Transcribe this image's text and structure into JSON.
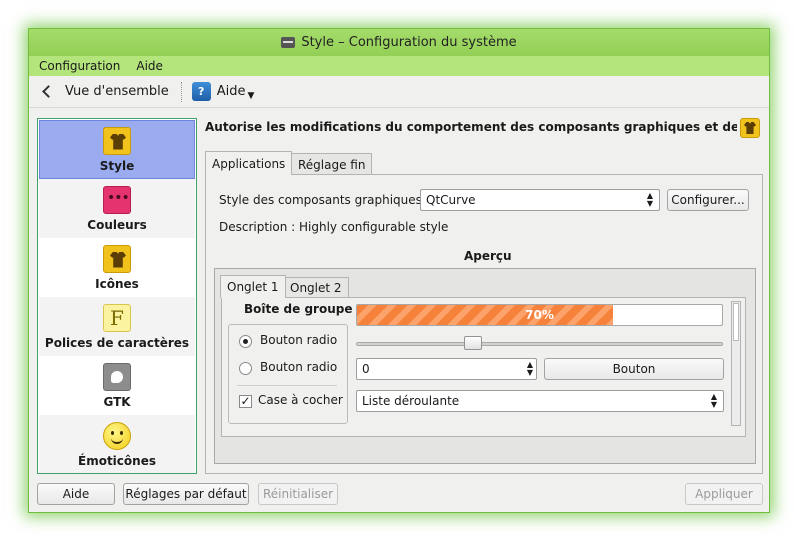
{
  "window": {
    "title": "Style – Configuration du système"
  },
  "menubar": {
    "items": [
      "Configuration",
      "Aide"
    ]
  },
  "toolbar": {
    "overview_label": "Vue d'ensemble",
    "help_label": "Aide"
  },
  "sidebar": {
    "items": [
      {
        "label": "Style",
        "icon": "shirt-icon",
        "selected": true
      },
      {
        "label": "Couleurs",
        "icon": "color-drops-icon",
        "selected": false
      },
      {
        "label": "Icônes",
        "icon": "shirt-icon",
        "selected": false
      },
      {
        "label": "Polices de caractères",
        "icon": "font-icon",
        "selected": false
      },
      {
        "label": "GTK",
        "icon": "gtk-icon",
        "selected": false
      },
      {
        "label": "Émoticônes",
        "icon": "smiley-icon",
        "selected": false
      }
    ]
  },
  "content": {
    "description": "Autorise les modifications du comportement des composants graphiques et des styles de KD",
    "tabs": [
      "Applications",
      "Réglage fin"
    ],
    "widget_style_label": "Style des composants graphiques :",
    "widget_style_value": "QtCurve",
    "configure_label": "Configurer...",
    "description_line": "Description : Highly configurable style",
    "preview_title": "Aperçu",
    "preview": {
      "tabs": [
        "Onglet 1",
        "Onglet 2"
      ],
      "groupbox_title": "Boîte de groupe",
      "radio1_label": "Bouton radio",
      "radio2_label": "Bouton radio",
      "checkbox_label": "Case à cocher",
      "progress_text": "70%",
      "progress_value": 70,
      "slider_value": 0.31,
      "spin_value": "0",
      "button_label": "Bouton",
      "dropdown_value": "Liste déroulante"
    }
  },
  "bottom": {
    "help_label": "Aide",
    "defaults_label": "Réglages par défaut",
    "reset_label": "Réinitialiser",
    "apply_label": "Appliquer"
  },
  "colors": {
    "accent_green": "#6fbf3c",
    "selection": "#9aabf0",
    "progress": "#f6813a"
  }
}
